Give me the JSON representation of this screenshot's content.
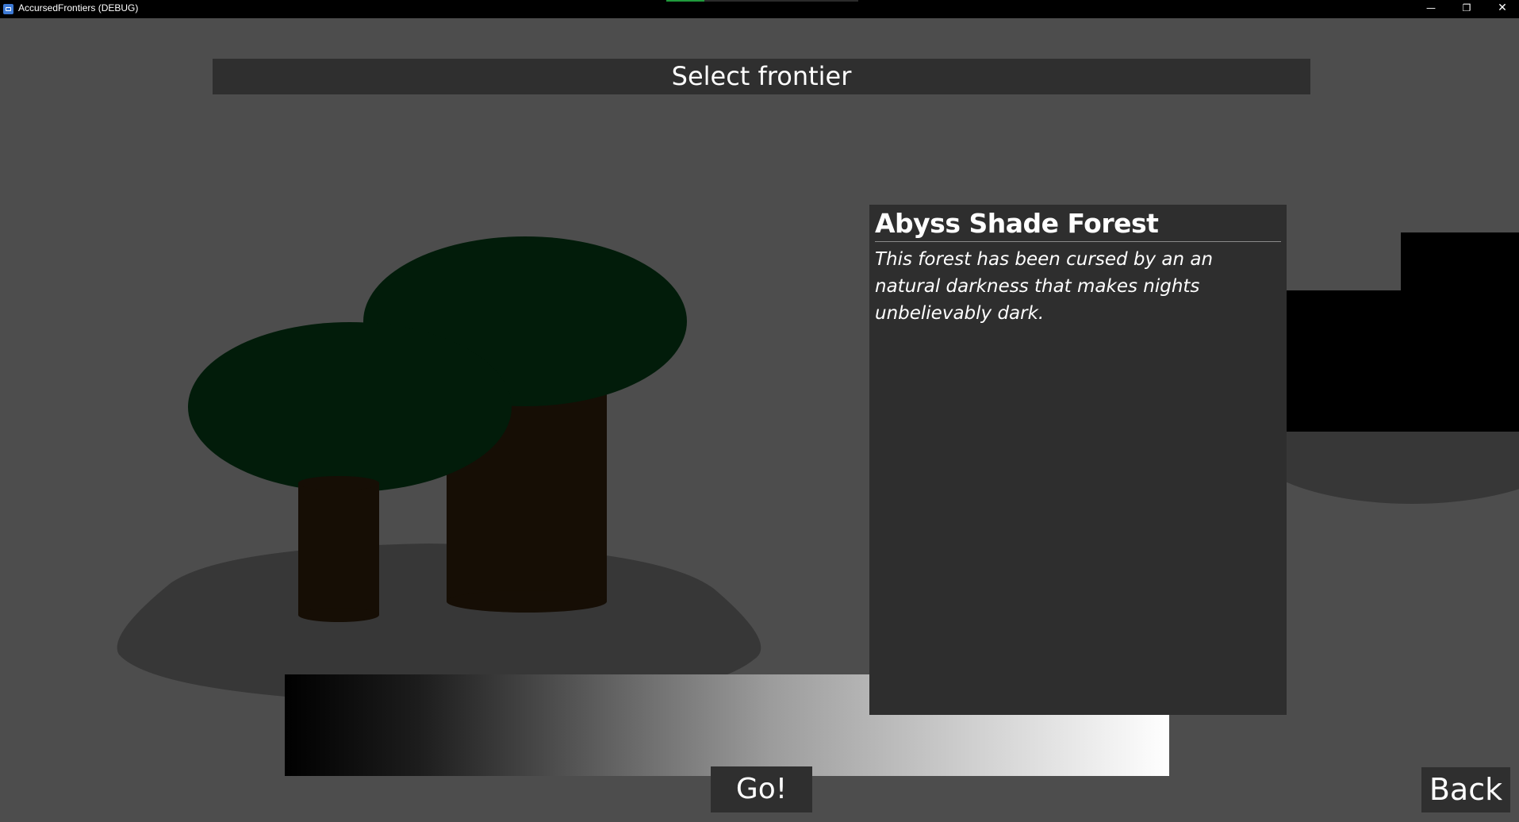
{
  "window": {
    "title": "AccursedFrontiers (DEBUG)",
    "loading_progress": 0.2
  },
  "header": {
    "title": "Select frontier"
  },
  "frontier": {
    "name": "Abyss Shade Forest",
    "description": "This forest has been cursed by an an natural darkness that makes nights unbelievably dark."
  },
  "buttons": {
    "go_label": "Go!",
    "back_label": "Back"
  },
  "colors": {
    "background": "#4d4d4d",
    "panel": "#2e2e2e",
    "foliage": "#021c0a",
    "trunk": "#160e05",
    "ground": "#373737"
  },
  "icons": {
    "app": "app-icon",
    "minimize": "minimize-icon",
    "restore": "restore-icon",
    "close": "close-icon"
  }
}
